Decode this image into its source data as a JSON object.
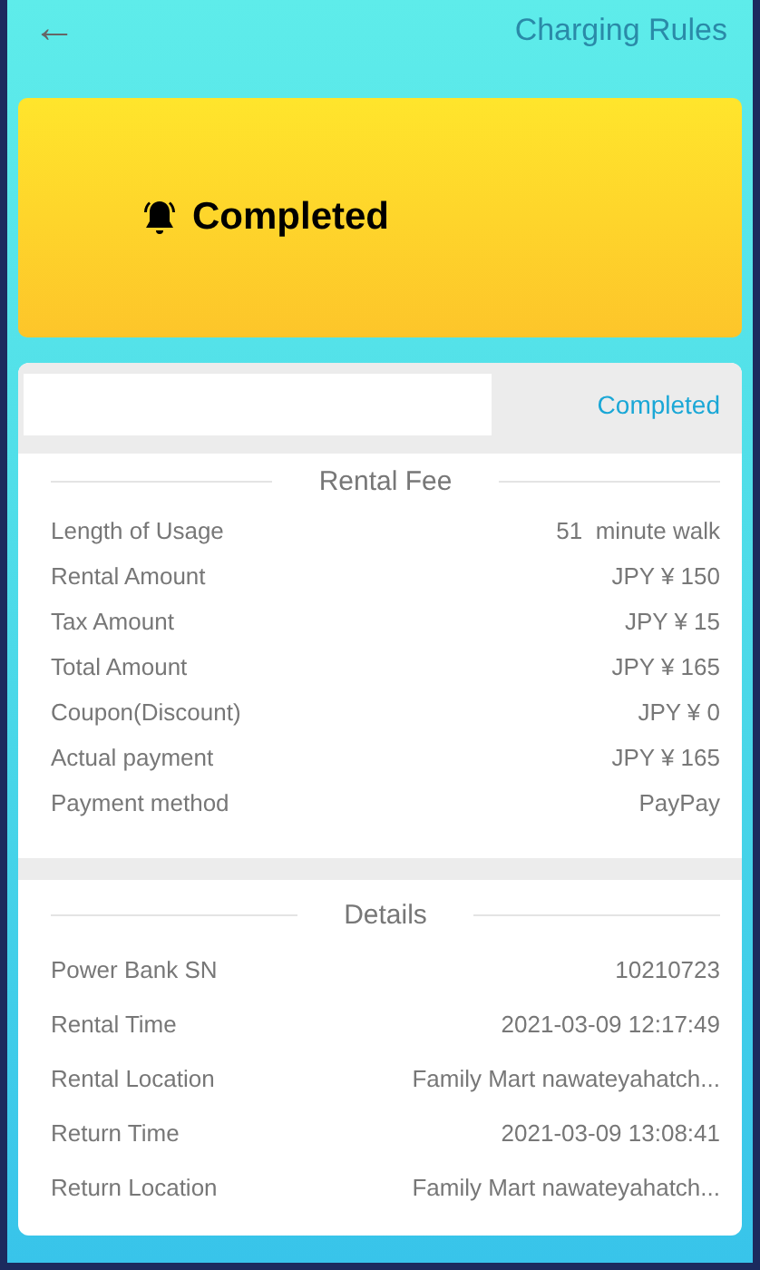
{
  "header": {
    "back": "←",
    "link": "Charging Rules"
  },
  "banner": {
    "status": "Completed"
  },
  "order": {
    "status": "Completed"
  },
  "rental_fee": {
    "title": "Rental Fee",
    "rows": [
      {
        "label": "Length of Usage",
        "value": "51  minute walk"
      },
      {
        "label": "Rental Amount",
        "value": "JPY ¥ 150"
      },
      {
        "label": "Tax Amount",
        "value": "JPY ¥ 15"
      },
      {
        "label": "Total Amount",
        "value": "JPY ¥ 165"
      },
      {
        "label": "Coupon(Discount)",
        "value": "JPY ¥ 0"
      },
      {
        "label": "Actual payment",
        "value": "JPY ¥ 165"
      },
      {
        "label": "Payment method",
        "value": "PayPay"
      }
    ]
  },
  "details": {
    "title": "Details",
    "rows": [
      {
        "label": "Power Bank SN",
        "value": "10210723"
      },
      {
        "label": "Rental Time",
        "value": "2021-03-09 12:17:49"
      },
      {
        "label": "Rental Location",
        "value": "Family Mart nawateyahatch..."
      },
      {
        "label": "Return Time",
        "value": "2021-03-09 13:08:41"
      },
      {
        "label": "Return Location",
        "value": "Family Mart nawateyahatch..."
      }
    ]
  }
}
